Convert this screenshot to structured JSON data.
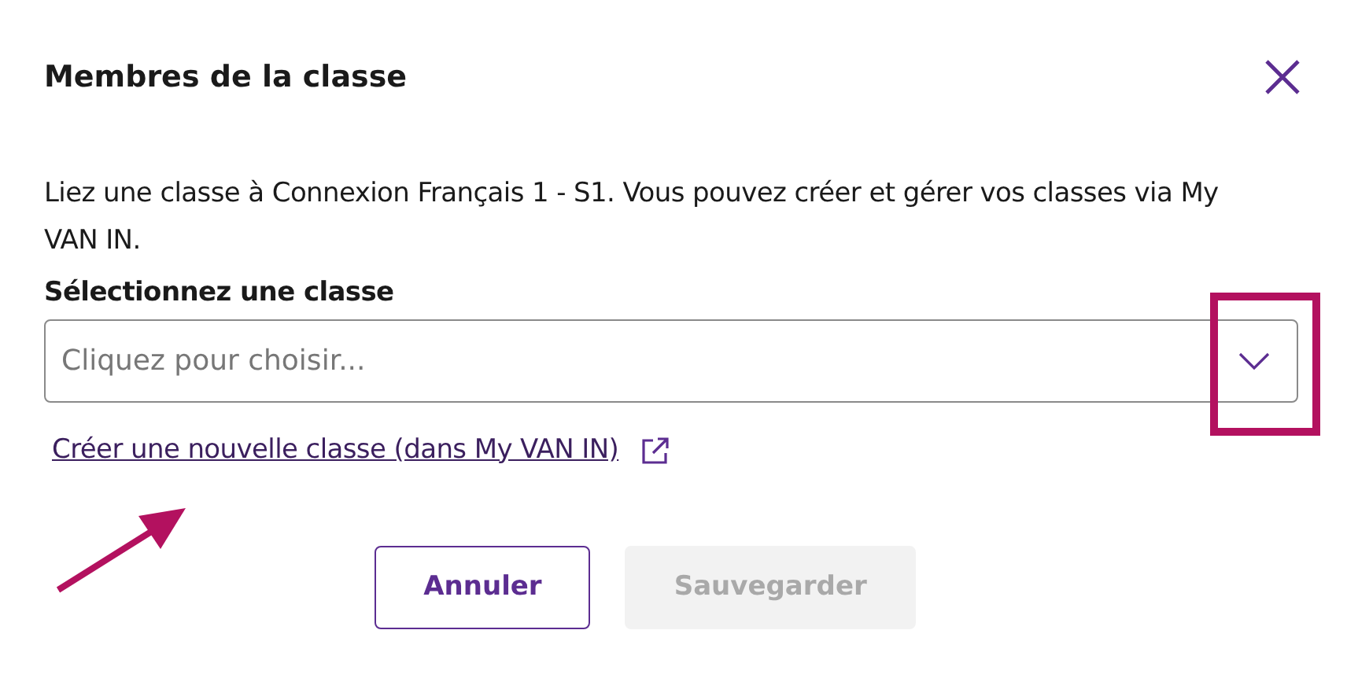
{
  "dialog": {
    "title": "Membres de la classe"
  },
  "description": "Liez une classe à Connexion Français 1 - S1. Vous pouvez créer et gérer vos classes via My VAN IN.",
  "select": {
    "label": "Sélectionnez une classe",
    "placeholder": "Cliquez pour choisir..."
  },
  "link": {
    "label": "Créer une nouvelle classe (dans My VAN IN)"
  },
  "buttons": [
    {
      "label": "Annuler",
      "kind": "secondary",
      "disabled": false
    },
    {
      "label": "Sauvegarder",
      "kind": "primary",
      "disabled": true
    }
  ],
  "highlight_box": {
    "color": "#b3115f"
  },
  "arrow": {
    "color": "#b3115f"
  }
}
